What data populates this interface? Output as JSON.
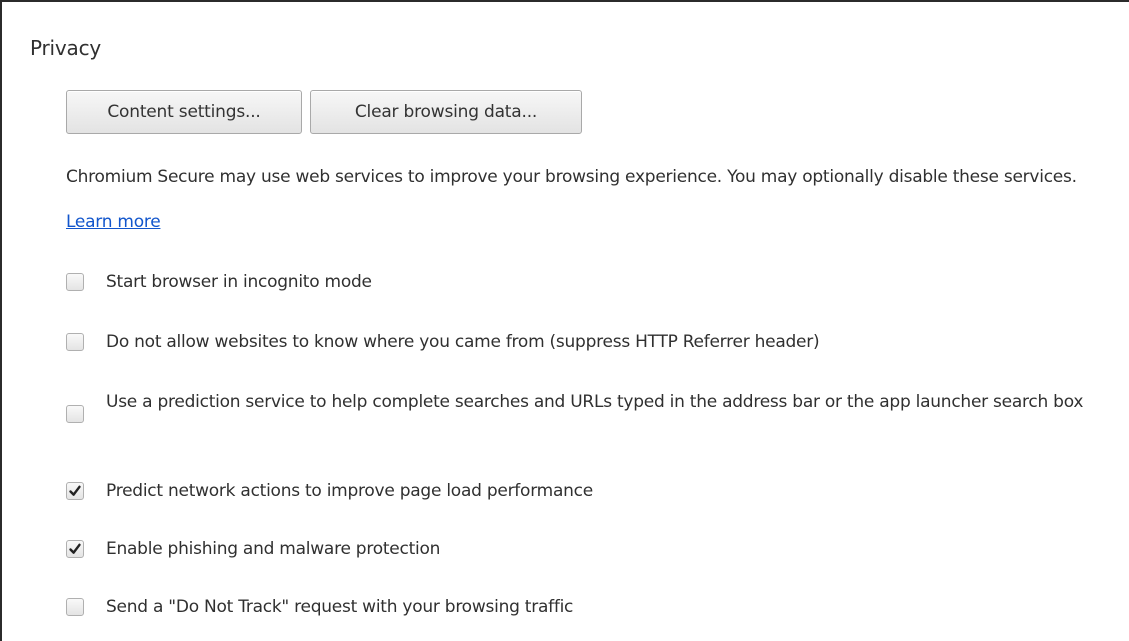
{
  "privacy": {
    "title": "Privacy",
    "buttons": {
      "content_settings": "Content settings...",
      "clear_browsing_data": "Clear browsing data..."
    },
    "description": {
      "text": "Chromium Secure may use web services to improve your browsing experience. You may optionally disable these services. ",
      "link": "Learn more"
    },
    "options": [
      {
        "label": "Start browser in incognito mode",
        "checked": false
      },
      {
        "label": "Do not allow websites to know where you came from (suppress HTTP Referrer header)",
        "checked": false
      },
      {
        "label": "Use a prediction service to help complete searches and URLs typed in the address bar or the app launcher search box",
        "checked": false
      },
      {
        "label": "Predict network actions to improve page load performance",
        "checked": true
      },
      {
        "label": "Enable phishing and malware protection",
        "checked": true
      },
      {
        "label": "Send a \"Do Not Track\" request with your browsing traffic",
        "checked": false
      }
    ]
  },
  "colors": {
    "link": "#1155cc",
    "text": "#303030",
    "checkmark": "#222222"
  },
  "icons": {
    "checked": "checkmark-icon"
  }
}
